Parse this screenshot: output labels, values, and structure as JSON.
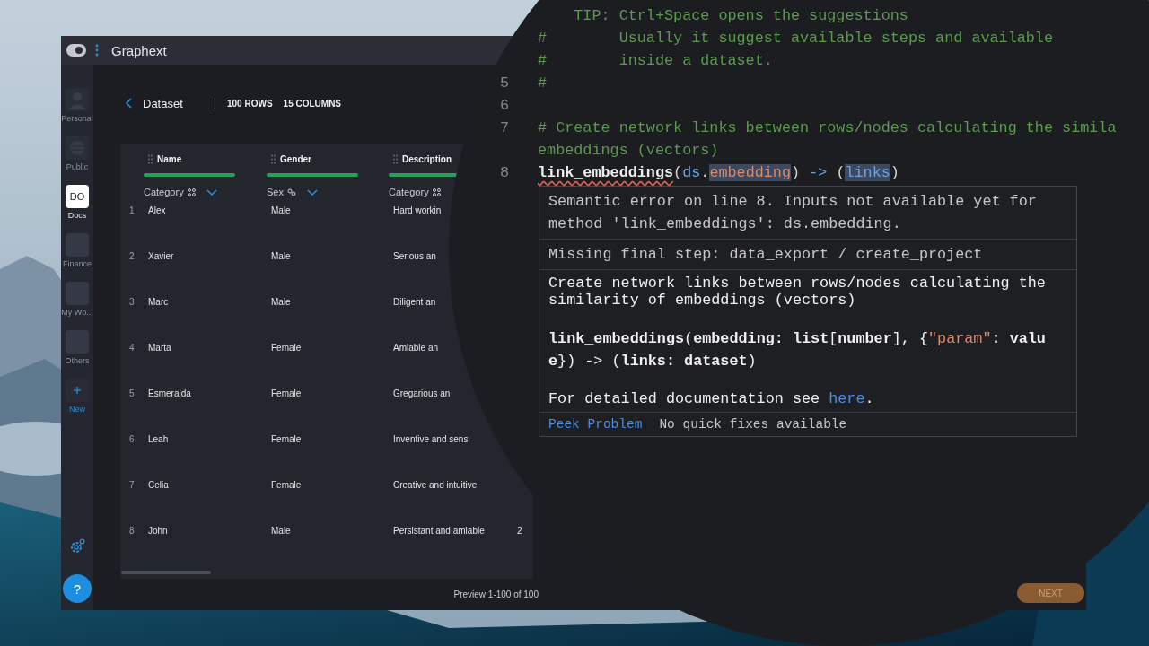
{
  "window": {
    "title": "Graphext"
  },
  "sidebar": {
    "items": [
      {
        "label": "Personal",
        "kind": "avatar",
        "selected": false
      },
      {
        "label": "Public",
        "kind": "globe",
        "selected": false
      },
      {
        "label": "Docs",
        "kind": "initials",
        "initials": "DO",
        "selected": true
      },
      {
        "label": "Finance",
        "kind": "tile",
        "selected": false
      },
      {
        "label": "My Wo...",
        "kind": "tile",
        "selected": false
      },
      {
        "label": "Others",
        "kind": "tile",
        "selected": false
      },
      {
        "label": "New",
        "kind": "new",
        "selected": false
      }
    ],
    "help_button": "?"
  },
  "dataset": {
    "title": "Dataset",
    "rows_count": "100 ROWS",
    "columns_count": "15 COLUMNS"
  },
  "table": {
    "columns": [
      {
        "name": "Name",
        "type": "Category",
        "kind": "category",
        "menu": true,
        "level": 1
      },
      {
        "name": "Gender",
        "type": "Sex",
        "kind": "sex",
        "menu": true,
        "level": 1
      },
      {
        "name": "Description",
        "type": "Category",
        "kind": "category",
        "menu": false,
        "level": 1
      }
    ],
    "rows": [
      {
        "index": "1",
        "cells": [
          "Alex",
          "Male",
          "Hard workin"
        ]
      },
      {
        "index": "2",
        "cells": [
          "Xavier",
          "Male",
          "Serious an"
        ]
      },
      {
        "index": "3",
        "cells": [
          "Marc",
          "Male",
          "Diligent an"
        ]
      },
      {
        "index": "4",
        "cells": [
          "Marta",
          "Female",
          "Amiable an"
        ]
      },
      {
        "index": "5",
        "cells": [
          "Esmeralda",
          "Female",
          "Gregarious an"
        ]
      },
      {
        "index": "6",
        "cells": [
          "Leah",
          "Female",
          "Inventive and sens"
        ]
      },
      {
        "index": "7",
        "cells": [
          "Celia",
          "Female",
          "Creative and intuitive"
        ]
      },
      {
        "index": "8",
        "cells": [
          "John",
          "Male",
          "Persistant and amiable",
          "2"
        ]
      }
    ]
  },
  "footer": {
    "preview": "Preview 1-100 of 100",
    "next_button": "NEXT"
  },
  "editor": {
    "lines": [
      {
        "kind": "comment",
        "text": "TIP: Ctrl+Space opens the suggestions"
      },
      {
        "kind": "comment",
        "text": "#        Usually it suggest available steps and available"
      },
      {
        "kind": "comment",
        "text": "#        inside a dataset."
      },
      {
        "number": "5",
        "kind": "comment",
        "text": "#"
      },
      {
        "number": "6",
        "kind": "blank"
      },
      {
        "number": "7",
        "kind": "comment",
        "text": "# Create network links between rows/nodes calculating the simila"
      },
      {
        "kind": "comment",
        "text": "embeddings (vectors)"
      },
      {
        "number": "8",
        "kind": "code",
        "tokens": [
          {
            "text": "link_embeddings",
            "kind": "function",
            "error": true,
            "highlighted": false
          },
          {
            "text": "(",
            "kind": "punct",
            "error": false,
            "highlighted": false
          },
          {
            "text": "ds",
            "kind": "name",
            "error": false,
            "highlighted": false
          },
          {
            "text": ".",
            "kind": "punct",
            "error": false,
            "highlighted": false
          },
          {
            "text": "embedding",
            "kind": "property",
            "error": false,
            "highlighted": true
          },
          {
            "text": ")",
            "kind": "punct",
            "error": false,
            "highlighted": false
          },
          {
            "text": "->",
            "kind": "operator",
            "error": false,
            "highlighted": false
          },
          {
            "text": "(",
            "kind": "punct",
            "error": false,
            "highlighted": false
          },
          {
            "text": "links",
            "kind": "name",
            "error": false,
            "highlighted": true
          },
          {
            "text": ")",
            "kind": "punct",
            "error": false,
            "highlighted": false
          }
        ]
      }
    ],
    "hover": {
      "message": "Semantic error on line 8. Inputs not available yet for method 'link_embeddings': ds.embedding.",
      "missing": "Missing final step: data_export / create_project",
      "description": "Create network links between rows/nodes calculating the similarity of embeddings (vectors)",
      "signature": [
        {
          "text": "link_embeddings",
          "kind": "bold"
        },
        {
          "text": "(",
          "kind": "plain"
        },
        {
          "text": "embedding: list",
          "kind": "bold"
        },
        {
          "text": "[",
          "kind": "plain"
        },
        {
          "text": "number",
          "kind": "bold"
        },
        {
          "text": "], {",
          "kind": "plain"
        },
        {
          "text": "\"param\"",
          "kind": "string"
        },
        {
          "text": ": value",
          "kind": "bold"
        },
        {
          "text": "}) -> (",
          "kind": "plain"
        },
        {
          "text": "links: dataset",
          "kind": "bold"
        },
        {
          "text": ")",
          "kind": "plain"
        }
      ],
      "doc": {
        "before": "For detailed documentation see",
        "link": "here",
        "after": "."
      },
      "status": {
        "action": "Peek Problem",
        "note": "No quick fixes available"
      }
    }
  }
}
